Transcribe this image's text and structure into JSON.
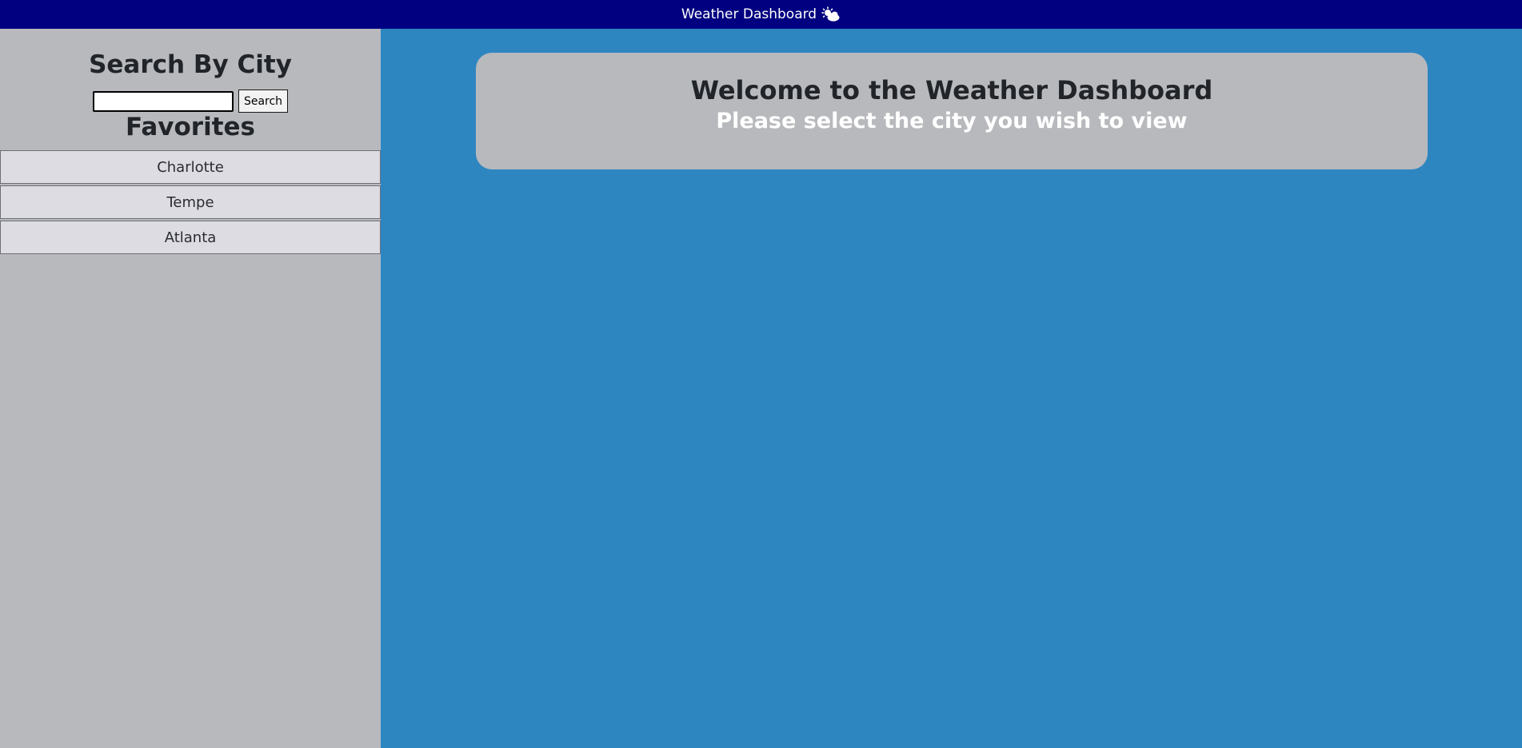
{
  "header": {
    "title": "Weather Dashboard",
    "icon": "sun-behind-cloud-icon"
  },
  "sidebar": {
    "search_title": "Search By City",
    "search_input": {
      "value": "",
      "placeholder": ""
    },
    "search_button_label": "Search",
    "favorites_title": "Favorites",
    "favorites": [
      {
        "label": "Charlotte"
      },
      {
        "label": "Tempe"
      },
      {
        "label": "Atlanta"
      }
    ]
  },
  "main": {
    "welcome_title": "Welcome to the Weather Dashboard",
    "welcome_subtitle": "Please select the city you wish to view"
  },
  "colors": {
    "header_bg": "#000080",
    "sidebar_bg": "#b8b9bd",
    "main_bg": "#2e86c1",
    "card_bg": "#b8b9bd",
    "favorite_bg": "#dcdce2"
  }
}
